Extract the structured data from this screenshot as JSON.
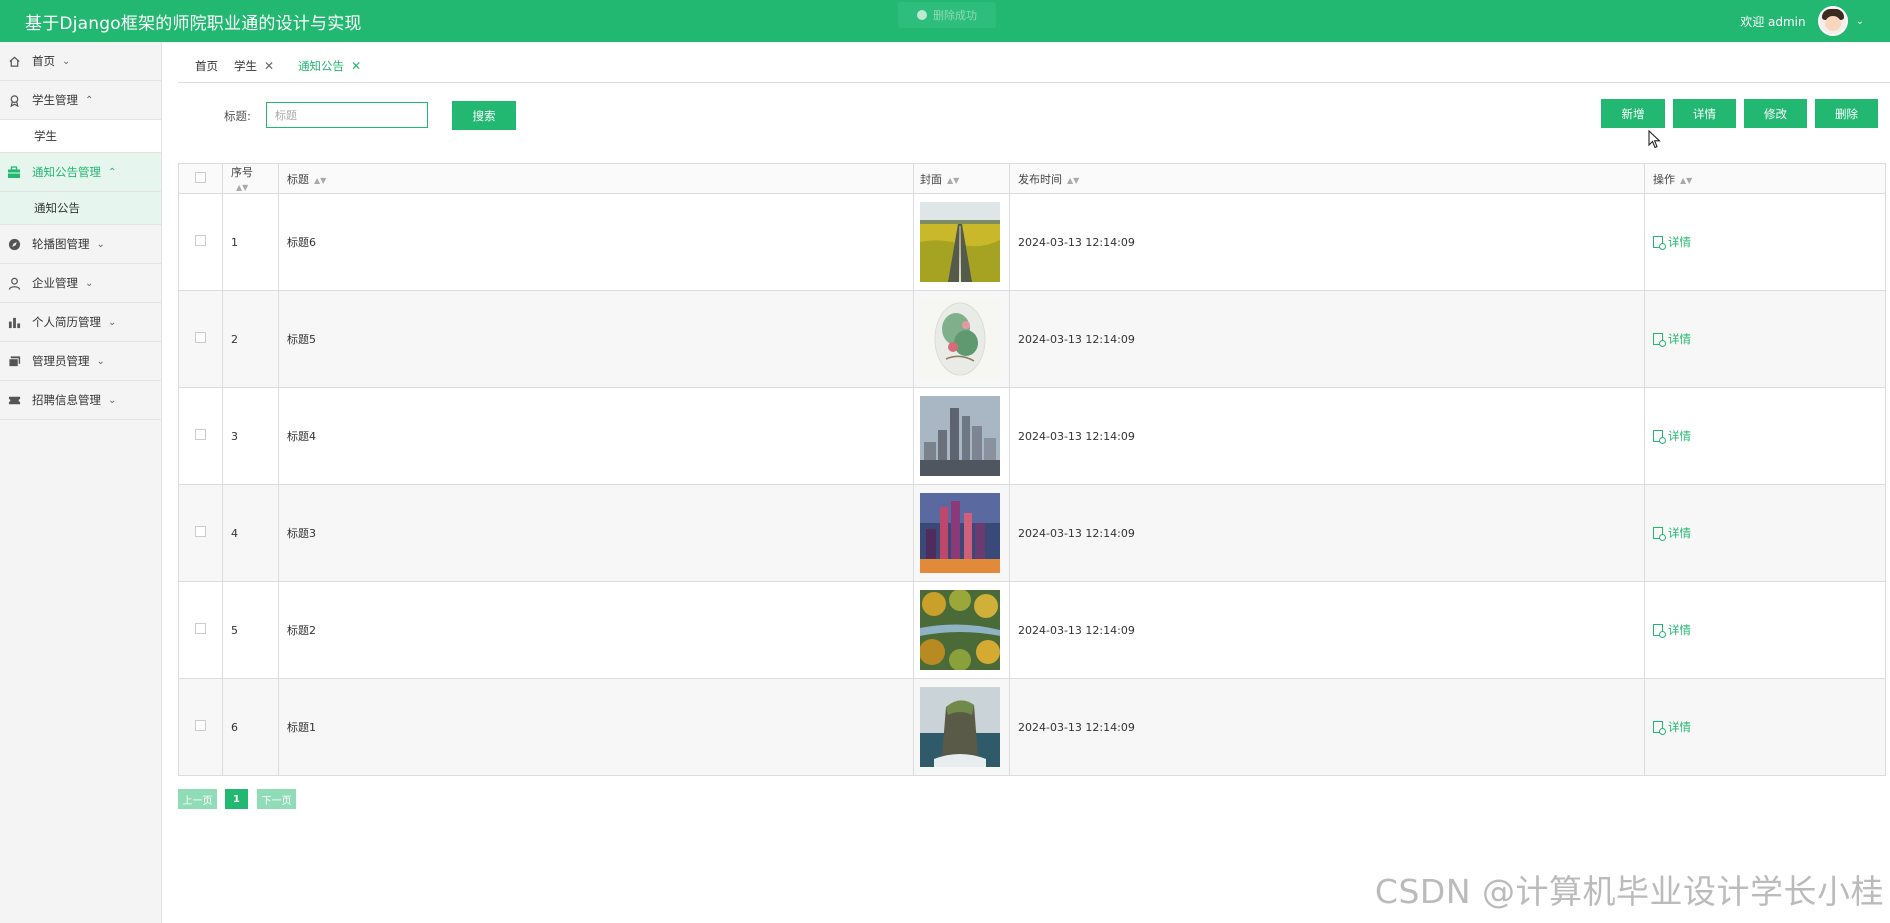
{
  "header": {
    "title": "基于Django框架的师院职业通的设计与实现",
    "toast": "删除成功",
    "welcome": "欢迎 admin",
    "color": "#22b872"
  },
  "sidebar": {
    "items": [
      {
        "label": "首页",
        "icon": "home-icon"
      },
      {
        "label": "学生管理",
        "icon": "badge-icon",
        "children": [
          {
            "label": "学生"
          }
        ]
      },
      {
        "label": "通知公告管理",
        "icon": "briefcase-icon",
        "children": [
          {
            "label": "通知公告"
          }
        ]
      },
      {
        "label": "轮播图管理",
        "icon": "compass-icon"
      },
      {
        "label": "企业管理",
        "icon": "user-icon"
      },
      {
        "label": "个人简历管理",
        "icon": "chart-icon"
      },
      {
        "label": "管理员管理",
        "icon": "folders-icon"
      },
      {
        "label": "招聘信息管理",
        "icon": "ticket-icon"
      }
    ]
  },
  "tabs": [
    {
      "label": "首页"
    },
    {
      "label": "学生"
    },
    {
      "label": "通知公告"
    }
  ],
  "search": {
    "label": "标题:",
    "placeholder": "标题",
    "button": "搜索"
  },
  "actions": {
    "add": "新增",
    "detail": "详情",
    "edit": "修改",
    "delete": "删除"
  },
  "table": {
    "headers": {
      "no": "序号",
      "title": "标题",
      "cover": "封面",
      "time": "发布时间",
      "ops": "操作"
    },
    "rows": [
      {
        "no": "1",
        "title": "标题6",
        "time": "2024-03-13 12:14:09",
        "cover": "field-road",
        "op": "详情"
      },
      {
        "no": "2",
        "title": "标题5",
        "time": "2024-03-13 12:14:09",
        "cover": "painted-plate",
        "op": "详情"
      },
      {
        "no": "3",
        "title": "标题4",
        "time": "2024-03-13 12:14:09",
        "cover": "city-skyline",
        "op": "详情"
      },
      {
        "no": "4",
        "title": "标题3",
        "time": "2024-03-13 12:14:09",
        "cover": "city-night",
        "op": "详情"
      },
      {
        "no": "5",
        "title": "标题2",
        "time": "2024-03-13 12:14:09",
        "cover": "autumn-trees",
        "op": "详情"
      },
      {
        "no": "6",
        "title": "标题1",
        "time": "2024-03-13 12:14:09",
        "cover": "sea-rock",
        "op": "详情"
      }
    ]
  },
  "pagination": {
    "prev": "上一页",
    "current": "1",
    "next": "下一页"
  },
  "watermark": "CSDN @计算机毕业设计学长小桂"
}
